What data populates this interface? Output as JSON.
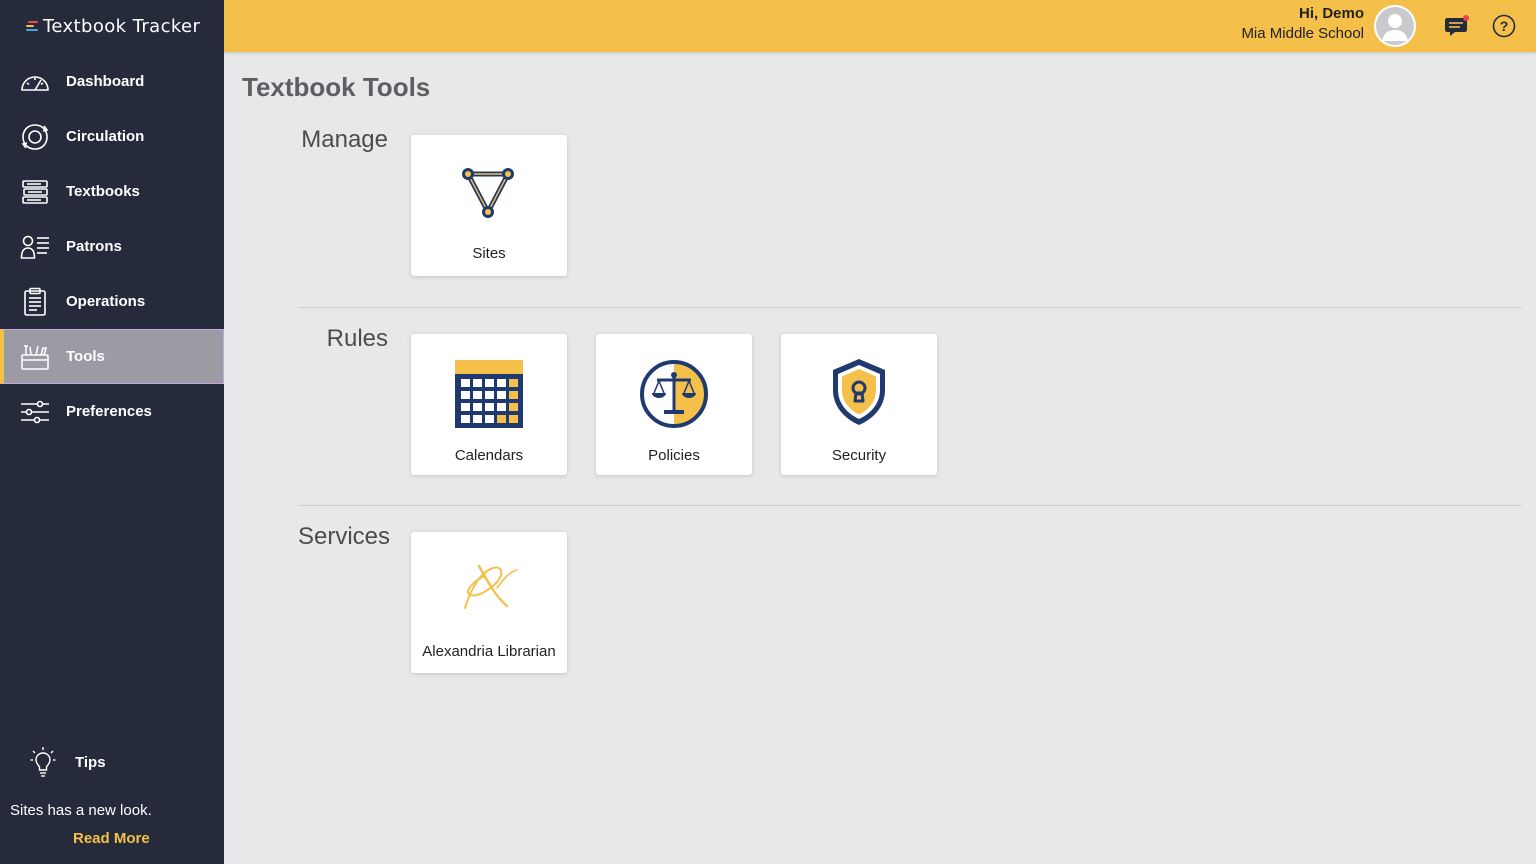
{
  "app": {
    "title": "Textbook Tracker"
  },
  "colors": {
    "sidebar_bg": "#262b3b",
    "accent": "#f4c04a",
    "navy": "#1f3a6e"
  },
  "sidebar": {
    "items": [
      {
        "label": "Dashboard",
        "icon": "dashboard-icon"
      },
      {
        "label": "Circulation",
        "icon": "circulation-icon"
      },
      {
        "label": "Textbooks",
        "icon": "textbooks-icon"
      },
      {
        "label": "Patrons",
        "icon": "patrons-icon"
      },
      {
        "label": "Operations",
        "icon": "operations-icon"
      },
      {
        "label": "Tools",
        "icon": "tools-icon",
        "active": true
      },
      {
        "label": "Preferences",
        "icon": "preferences-icon"
      }
    ],
    "tips": {
      "label": "Tips",
      "text": "Sites has a new look.",
      "link": "Read More"
    }
  },
  "header": {
    "greeting": "Hi, Demo",
    "school": "Mia Middle School"
  },
  "main": {
    "title": "Textbook Tools",
    "sections": [
      {
        "label": "Manage",
        "tiles": [
          {
            "label": "Sites",
            "icon": "sites-icon"
          }
        ]
      },
      {
        "label": "Rules",
        "tiles": [
          {
            "label": "Calendars",
            "icon": "calendar-icon"
          },
          {
            "label": "Policies",
            "icon": "scales-icon"
          },
          {
            "label": "Security",
            "icon": "shield-lock-icon"
          }
        ]
      },
      {
        "label": "Services",
        "tiles": [
          {
            "label": "Alexandria Librarian",
            "icon": "alexandria-logo-icon"
          }
        ]
      }
    ]
  }
}
